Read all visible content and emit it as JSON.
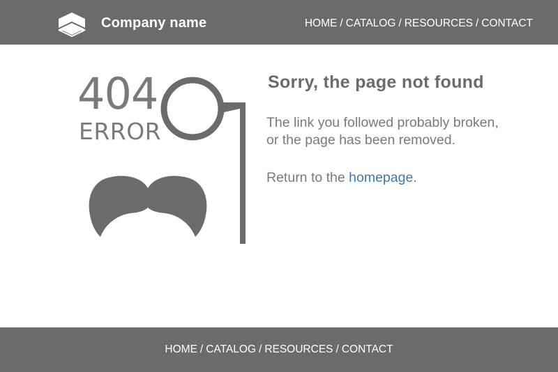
{
  "header": {
    "logo_icon": "hexagon-box-icon",
    "company_name": "Company name",
    "nav": [
      {
        "label": "HOME"
      },
      {
        "label": "CATALOG"
      },
      {
        "label": "RESOURCES"
      },
      {
        "label": "CONTACT"
      }
    ],
    "separator": "/"
  },
  "main": {
    "error_code": "404",
    "error_word": "ERROR",
    "illustration": [
      "monocle-icon",
      "mustache-icon"
    ],
    "title": "Sorry, the page not found",
    "description_line1": "The link you followed probably broken,",
    "description_line2": "or the page has been removed.",
    "return_prefix": "Return to the ",
    "return_link": "homepage",
    "return_suffix": "."
  },
  "footer": {
    "nav": [
      {
        "label": "HOME"
      },
      {
        "label": "CATALOG"
      },
      {
        "label": "RESOURCES"
      },
      {
        "label": "CONTACT"
      }
    ],
    "separator": "/"
  },
  "colors": {
    "bar": "#6b6b6b",
    "text": "#7a7a7a",
    "link": "#3a7ab5",
    "background": "#ffffff"
  }
}
